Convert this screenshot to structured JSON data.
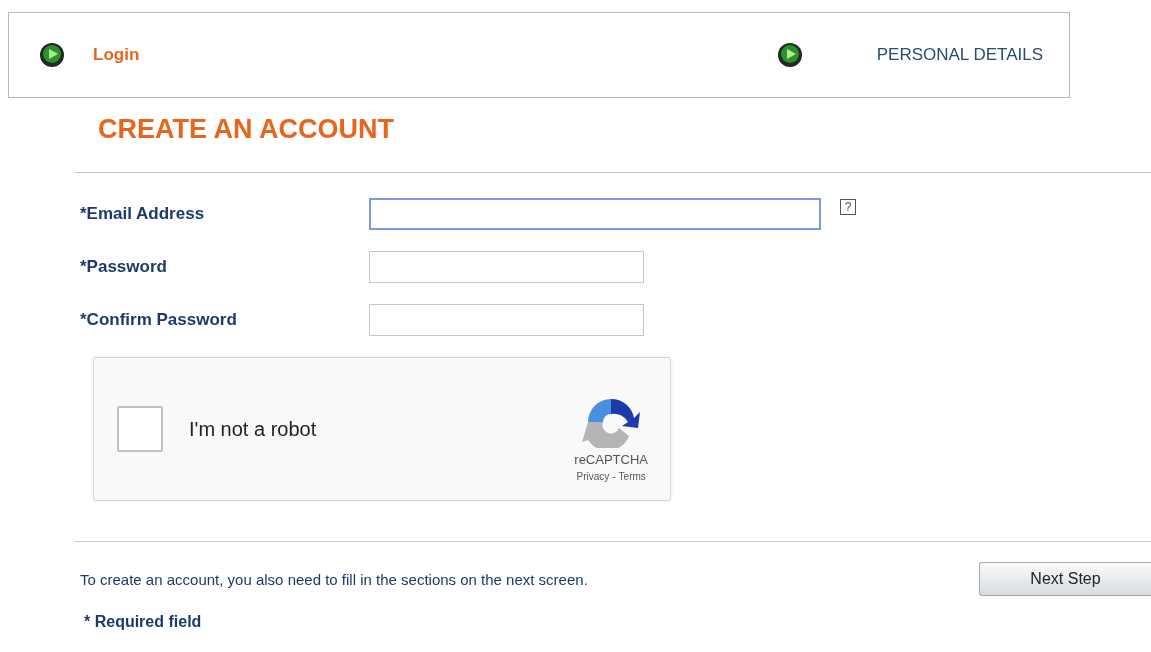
{
  "steps": [
    {
      "label": "Login",
      "selected": true
    },
    {
      "label": "PERSONAL DETAILS",
      "selected": false
    }
  ],
  "heading": "CREATE AN ACCOUNT",
  "fields": [
    {
      "label": "*Email Address",
      "focused": true,
      "wide": true,
      "help": "?"
    },
    {
      "label": "*Password",
      "focused": false,
      "wide": false
    },
    {
      "label": "*Confirm Password",
      "focused": false,
      "wide": false
    }
  ],
  "captcha": {
    "label": "I'm not a robot",
    "checked": false,
    "brand": "reCAPTCHA",
    "privacy": "Privacy",
    "separator": "-",
    "terms": "Terms"
  },
  "note": "To create an account, you also need to fill in the sections on the next screen.",
  "next_button": "Next Step",
  "required_note": "* Required field"
}
